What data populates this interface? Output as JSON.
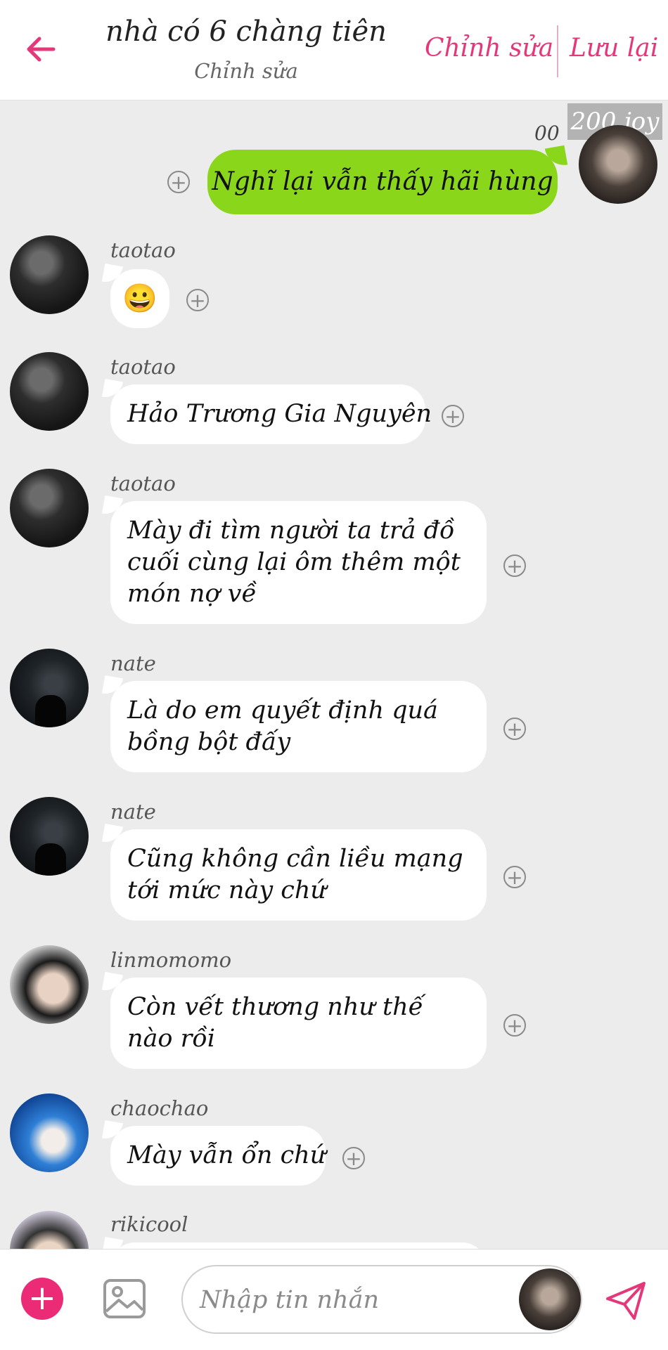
{
  "header": {
    "title": "nhà có 6 chàng tiên",
    "subtitle": "Chỉnh sửa",
    "edit_label": "Chỉnh sửa",
    "save_label": "Lưu lại",
    "accent_color": "#e4387b"
  },
  "self_message": {
    "count": "00",
    "sender": "200 joy",
    "text": "Nghĩ lại vẫn thấy hãi hùng",
    "bubble_color": "#8ad61a"
  },
  "messages": [
    {
      "sender": "taotao",
      "text": "😀",
      "emoji": true
    },
    {
      "sender": "taotao",
      "text": "Hảo Trương Gia Nguyên"
    },
    {
      "sender": "taotao",
      "text": "Mày đi tìm người ta trả đồ cuối cùng lại ôm thêm một món nợ về"
    },
    {
      "sender": "nate",
      "text": "Là do em quyết định quá bồng bột đấy"
    },
    {
      "sender": "nate",
      "text": "Cũng không cần liều mạng tới mức này chứ"
    },
    {
      "sender": "linmomomo",
      "text": "Còn vết thương như thế nào rồi"
    },
    {
      "sender": "chaochao",
      "text": "Mày vẫn ổn chứ"
    },
    {
      "sender": "rikicool",
      "text": ""
    }
  ],
  "input": {
    "placeholder": "Nhập tin nhắn",
    "add_icon": "plus-circle-icon",
    "image_icon": "image-icon",
    "send_icon": "send-icon"
  }
}
